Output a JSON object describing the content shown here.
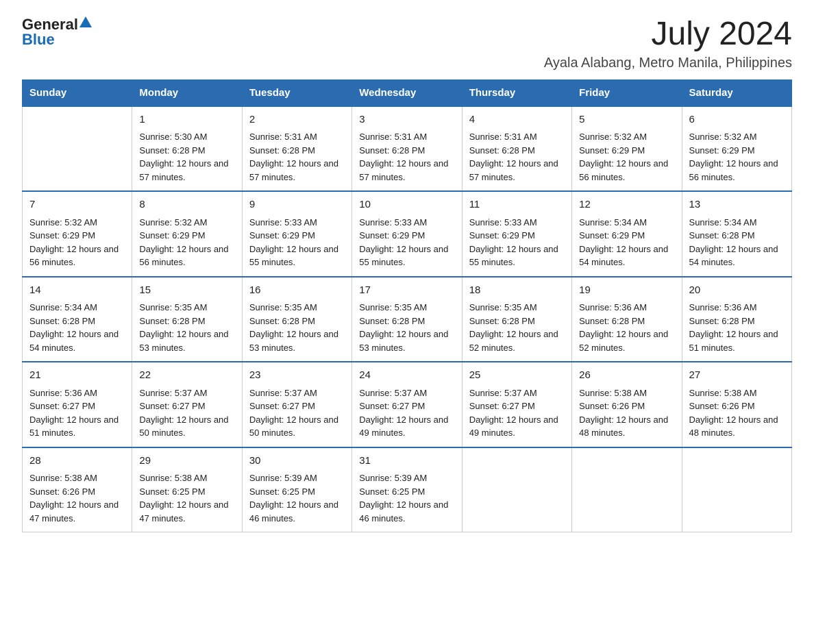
{
  "logo": {
    "text_general": "General",
    "text_blue": "Blue",
    "triangle": "▲"
  },
  "title": "July 2024",
  "subtitle": "Ayala Alabang, Metro Manila, Philippines",
  "days_of_week": [
    "Sunday",
    "Monday",
    "Tuesday",
    "Wednesday",
    "Thursday",
    "Friday",
    "Saturday"
  ],
  "weeks": [
    [
      {
        "day": "",
        "sunrise": "",
        "sunset": "",
        "daylight": ""
      },
      {
        "day": "1",
        "sunrise": "Sunrise: 5:30 AM",
        "sunset": "Sunset: 6:28 PM",
        "daylight": "Daylight: 12 hours and 57 minutes."
      },
      {
        "day": "2",
        "sunrise": "Sunrise: 5:31 AM",
        "sunset": "Sunset: 6:28 PM",
        "daylight": "Daylight: 12 hours and 57 minutes."
      },
      {
        "day": "3",
        "sunrise": "Sunrise: 5:31 AM",
        "sunset": "Sunset: 6:28 PM",
        "daylight": "Daylight: 12 hours and 57 minutes."
      },
      {
        "day": "4",
        "sunrise": "Sunrise: 5:31 AM",
        "sunset": "Sunset: 6:28 PM",
        "daylight": "Daylight: 12 hours and 57 minutes."
      },
      {
        "day": "5",
        "sunrise": "Sunrise: 5:32 AM",
        "sunset": "Sunset: 6:29 PM",
        "daylight": "Daylight: 12 hours and 56 minutes."
      },
      {
        "day": "6",
        "sunrise": "Sunrise: 5:32 AM",
        "sunset": "Sunset: 6:29 PM",
        "daylight": "Daylight: 12 hours and 56 minutes."
      }
    ],
    [
      {
        "day": "7",
        "sunrise": "Sunrise: 5:32 AM",
        "sunset": "Sunset: 6:29 PM",
        "daylight": "Daylight: 12 hours and 56 minutes."
      },
      {
        "day": "8",
        "sunrise": "Sunrise: 5:32 AM",
        "sunset": "Sunset: 6:29 PM",
        "daylight": "Daylight: 12 hours and 56 minutes."
      },
      {
        "day": "9",
        "sunrise": "Sunrise: 5:33 AM",
        "sunset": "Sunset: 6:29 PM",
        "daylight": "Daylight: 12 hours and 55 minutes."
      },
      {
        "day": "10",
        "sunrise": "Sunrise: 5:33 AM",
        "sunset": "Sunset: 6:29 PM",
        "daylight": "Daylight: 12 hours and 55 minutes."
      },
      {
        "day": "11",
        "sunrise": "Sunrise: 5:33 AM",
        "sunset": "Sunset: 6:29 PM",
        "daylight": "Daylight: 12 hours and 55 minutes."
      },
      {
        "day": "12",
        "sunrise": "Sunrise: 5:34 AM",
        "sunset": "Sunset: 6:29 PM",
        "daylight": "Daylight: 12 hours and 54 minutes."
      },
      {
        "day": "13",
        "sunrise": "Sunrise: 5:34 AM",
        "sunset": "Sunset: 6:28 PM",
        "daylight": "Daylight: 12 hours and 54 minutes."
      }
    ],
    [
      {
        "day": "14",
        "sunrise": "Sunrise: 5:34 AM",
        "sunset": "Sunset: 6:28 PM",
        "daylight": "Daylight: 12 hours and 54 minutes."
      },
      {
        "day": "15",
        "sunrise": "Sunrise: 5:35 AM",
        "sunset": "Sunset: 6:28 PM",
        "daylight": "Daylight: 12 hours and 53 minutes."
      },
      {
        "day": "16",
        "sunrise": "Sunrise: 5:35 AM",
        "sunset": "Sunset: 6:28 PM",
        "daylight": "Daylight: 12 hours and 53 minutes."
      },
      {
        "day": "17",
        "sunrise": "Sunrise: 5:35 AM",
        "sunset": "Sunset: 6:28 PM",
        "daylight": "Daylight: 12 hours and 53 minutes."
      },
      {
        "day": "18",
        "sunrise": "Sunrise: 5:35 AM",
        "sunset": "Sunset: 6:28 PM",
        "daylight": "Daylight: 12 hours and 52 minutes."
      },
      {
        "day": "19",
        "sunrise": "Sunrise: 5:36 AM",
        "sunset": "Sunset: 6:28 PM",
        "daylight": "Daylight: 12 hours and 52 minutes."
      },
      {
        "day": "20",
        "sunrise": "Sunrise: 5:36 AM",
        "sunset": "Sunset: 6:28 PM",
        "daylight": "Daylight: 12 hours and 51 minutes."
      }
    ],
    [
      {
        "day": "21",
        "sunrise": "Sunrise: 5:36 AM",
        "sunset": "Sunset: 6:27 PM",
        "daylight": "Daylight: 12 hours and 51 minutes."
      },
      {
        "day": "22",
        "sunrise": "Sunrise: 5:37 AM",
        "sunset": "Sunset: 6:27 PM",
        "daylight": "Daylight: 12 hours and 50 minutes."
      },
      {
        "day": "23",
        "sunrise": "Sunrise: 5:37 AM",
        "sunset": "Sunset: 6:27 PM",
        "daylight": "Daylight: 12 hours and 50 minutes."
      },
      {
        "day": "24",
        "sunrise": "Sunrise: 5:37 AM",
        "sunset": "Sunset: 6:27 PM",
        "daylight": "Daylight: 12 hours and 49 minutes."
      },
      {
        "day": "25",
        "sunrise": "Sunrise: 5:37 AM",
        "sunset": "Sunset: 6:27 PM",
        "daylight": "Daylight: 12 hours and 49 minutes."
      },
      {
        "day": "26",
        "sunrise": "Sunrise: 5:38 AM",
        "sunset": "Sunset: 6:26 PM",
        "daylight": "Daylight: 12 hours and 48 minutes."
      },
      {
        "day": "27",
        "sunrise": "Sunrise: 5:38 AM",
        "sunset": "Sunset: 6:26 PM",
        "daylight": "Daylight: 12 hours and 48 minutes."
      }
    ],
    [
      {
        "day": "28",
        "sunrise": "Sunrise: 5:38 AM",
        "sunset": "Sunset: 6:26 PM",
        "daylight": "Daylight: 12 hours and 47 minutes."
      },
      {
        "day": "29",
        "sunrise": "Sunrise: 5:38 AM",
        "sunset": "Sunset: 6:25 PM",
        "daylight": "Daylight: 12 hours and 47 minutes."
      },
      {
        "day": "30",
        "sunrise": "Sunrise: 5:39 AM",
        "sunset": "Sunset: 6:25 PM",
        "daylight": "Daylight: 12 hours and 46 minutes."
      },
      {
        "day": "31",
        "sunrise": "Sunrise: 5:39 AM",
        "sunset": "Sunset: 6:25 PM",
        "daylight": "Daylight: 12 hours and 46 minutes."
      },
      {
        "day": "",
        "sunrise": "",
        "sunset": "",
        "daylight": ""
      },
      {
        "day": "",
        "sunrise": "",
        "sunset": "",
        "daylight": ""
      },
      {
        "day": "",
        "sunrise": "",
        "sunset": "",
        "daylight": ""
      }
    ]
  ]
}
